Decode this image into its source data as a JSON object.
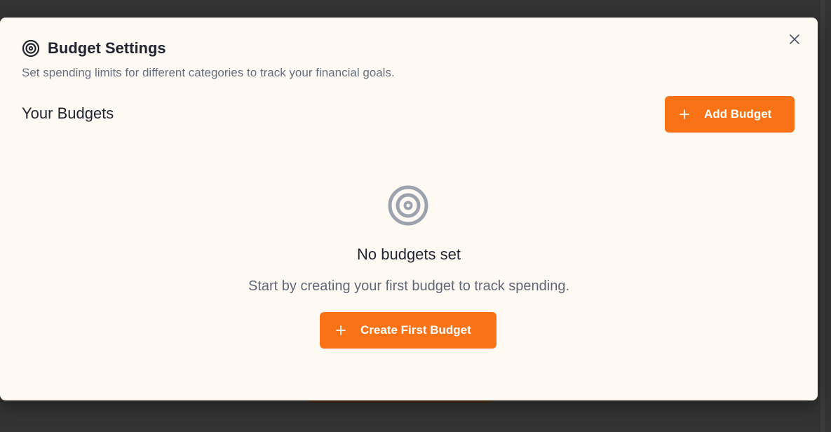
{
  "dialog": {
    "title": "Budget Settings",
    "title_icon": "target-icon",
    "subtitle": "Set spending limits for different categories to track your financial goals.",
    "close_icon": "close-icon"
  },
  "section": {
    "title": "Your Budgets",
    "add_button_label": "Add Budget",
    "add_icon": "plus-icon"
  },
  "empty_state": {
    "icon": "target-icon",
    "title": "No budgets set",
    "description": "Start by creating your first budget to track spending.",
    "create_button_label": "Create First Budget",
    "create_icon": "plus-icon"
  },
  "colors": {
    "accent": "#f97316",
    "dialog_background": "#fff9f4",
    "backdrop": "#333333",
    "muted_icon": "#9ca3af"
  }
}
